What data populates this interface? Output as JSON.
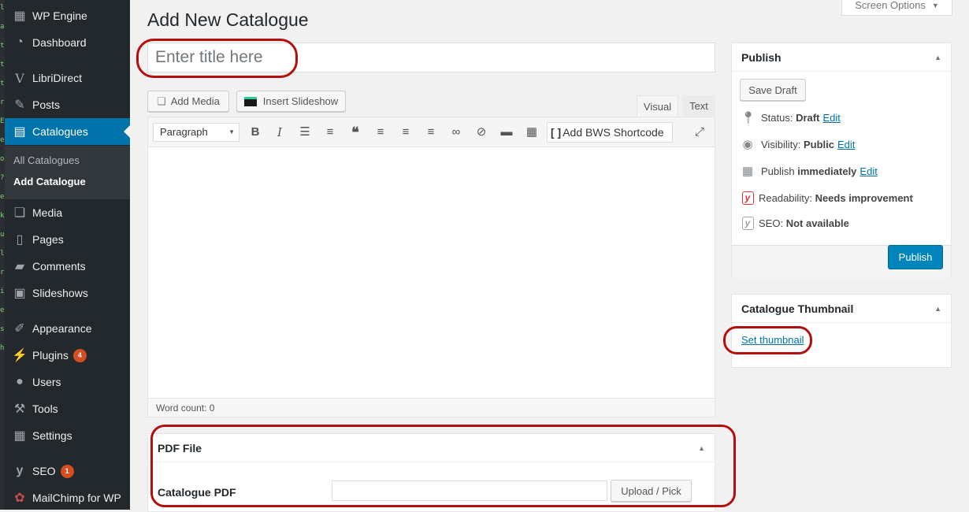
{
  "left_sliver": [
    "l",
    "a",
    "t",
    "t",
    "t",
    "r",
    "E",
    "e",
    "o",
    "?",
    "e",
    "k",
    "u",
    "l",
    "r",
    "i",
    "e",
    "s",
    "h"
  ],
  "sidebar": {
    "items": [
      {
        "label": "WP Engine",
        "icon": "grid-icon"
      },
      {
        "label": "Dashboard",
        "icon": "dashboard-icon"
      },
      {
        "label": "LibriDirect",
        "icon": "v-logo-icon"
      },
      {
        "label": "Posts",
        "icon": "pin-icon"
      },
      {
        "label": "Catalogues",
        "icon": "document-icon"
      },
      {
        "label": "Media",
        "icon": "media-icon"
      },
      {
        "label": "Pages",
        "icon": "pages-icon"
      },
      {
        "label": "Comments",
        "icon": "comment-icon"
      },
      {
        "label": "Slideshows",
        "icon": "image-icon"
      },
      {
        "label": "Appearance",
        "icon": "brush-icon"
      },
      {
        "label": "Plugins",
        "icon": "plug-icon",
        "badge": "4"
      },
      {
        "label": "Users",
        "icon": "user-icon"
      },
      {
        "label": "Tools",
        "icon": "wrench-icon"
      },
      {
        "label": "Settings",
        "icon": "settings-icon"
      },
      {
        "label": "SEO",
        "icon": "yoast-icon",
        "badge": "1"
      },
      {
        "label": "MailChimp for WP",
        "icon": "mailchimp-icon"
      }
    ],
    "submenu": [
      "All Catalogues",
      "Add Catalogue"
    ]
  },
  "page": {
    "title": "Add New Catalogue",
    "screen_options": "Screen Options",
    "title_placeholder": "Enter title here"
  },
  "editor": {
    "add_media": "Add Media",
    "insert_slideshow": "Insert Slideshow",
    "tab_visual": "Visual",
    "tab_text": "Text",
    "format_select": "Paragraph",
    "bws_shortcode": "Add BWS Shortcode",
    "word_count": "Word count: 0"
  },
  "publish": {
    "header": "Publish",
    "save_draft": "Save Draft",
    "status_label": "Status:",
    "status_value": "Draft",
    "visibility_label": "Visibility:",
    "visibility_value": "Public",
    "publish_label": "Publish",
    "publish_value": "immediately",
    "readability_label": "Readability:",
    "readability_value": "Needs improvement",
    "seo_label": "SEO:",
    "seo_value": "Not available",
    "edit": "Edit",
    "publish_button": "Publish"
  },
  "thumbnail": {
    "header": "Catalogue Thumbnail",
    "set_link": "Set thumbnail"
  },
  "pdf": {
    "header": "PDF File",
    "label": "Catalogue PDF",
    "button": "Upload / Pick"
  },
  "colors": {
    "accent": "#0073aa",
    "sidebar": "#23282d",
    "annotation_ring": "#b40f0f",
    "readability_red": "#dc3232"
  }
}
